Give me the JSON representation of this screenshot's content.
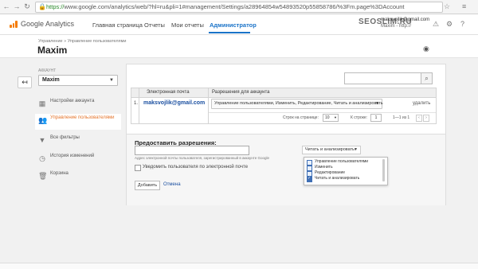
{
  "browser": {
    "url_scheme": "https://",
    "url_rest": "www.google.com/analytics/web/?hl=ru&pli=1#management/Settings/a28964854w54893520p55858786/%3Fm.page%3DAccount"
  },
  "header": {
    "logo_text": "Google Analytics",
    "tabs": [
      "Главная страница",
      "Отчеты",
      "Мои отчеты",
      "Администратор"
    ],
    "account_email": "maksvojlik@gmail.com",
    "account_name": "Maxim - http://",
    "brand_color": "#f57c00",
    "active_color": "#1a73c8"
  },
  "watermark": "SEOSLIM.RU",
  "titlebar": {
    "breadcrumb": "Управление » Управление пользователями",
    "title": "Maxim"
  },
  "sidebar": {
    "account_label": "АККАУНТ",
    "account_value": "Maxim",
    "items": [
      {
        "label": "Настройки аккаунта",
        "icon": "building-icon"
      },
      {
        "label": "Управление пользователями",
        "icon": "users-icon",
        "active": true
      },
      {
        "label": "Все фильтры",
        "icon": "filter-icon"
      },
      {
        "label": "История изменений",
        "icon": "history-icon"
      },
      {
        "label": "Корзина",
        "icon": "trash-icon"
      }
    ]
  },
  "users_table": {
    "columns": [
      "Электронная почта",
      "Разрешения для аккаунта"
    ],
    "rows": [
      {
        "num": "1.",
        "email": "maksvojlik@gmail.com",
        "permissions": "Управление пользователями, Изменить, Редактирование, Читать и анализировать",
        "action": "удалить"
      }
    ],
    "pager": {
      "rows_label": "Строк на странице:",
      "rows_value": "10",
      "goto_label": "К строке:",
      "goto_value": "1",
      "range": "1—1 из 1"
    }
  },
  "grant": {
    "title": "Предоставить разрешения:",
    "email_hint": "Адрес электронной почты пользователя, зарегистрированный в аккаунте Google",
    "notify_label": "Уведомить пользователя по электронной почте",
    "permission_value": "Читать и анализировать",
    "add_label": "Добавить",
    "cancel_label": "Отмена",
    "options": [
      {
        "label": "Управление пользователями",
        "checked": false
      },
      {
        "label": "Изменить",
        "checked": false
      },
      {
        "label": "Редактирование",
        "checked": false
      },
      {
        "label": "Читать и анализировать",
        "checked": true
      }
    ]
  }
}
